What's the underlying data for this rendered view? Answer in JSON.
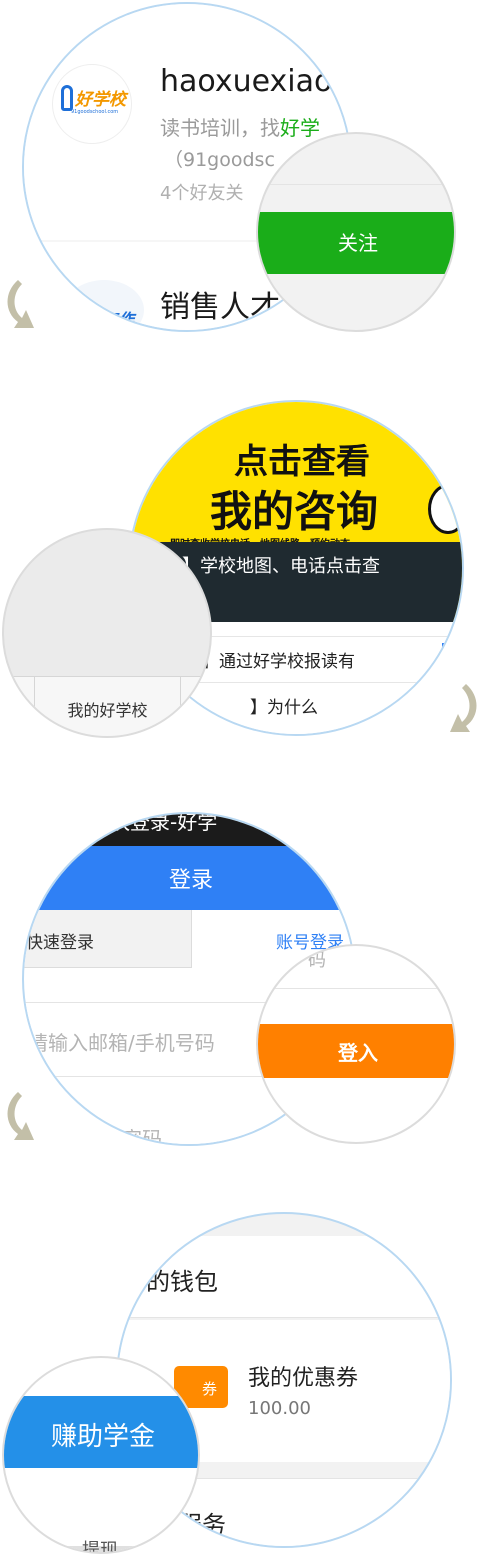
{
  "panel1": {
    "account_name": "haoxuexiao",
    "description_prefix": "读书培训，找",
    "description_highlight": "好学",
    "account_id": "（91goodsc",
    "friends_text": "4个好友关",
    "logo_text": "好学校",
    "logo_sub": "91goodschool.com",
    "next_account_name": "销售人才",
    "next_logo_text": "工作",
    "follow_button": "关注",
    "colors": {
      "follow": "#1aad19",
      "highlight": "#1aad19",
      "logo_blue": "#1e6fd8",
      "logo_orange": "#f39800"
    }
  },
  "panel2": {
    "banner_line1": "点击查看",
    "banner_line2": "我的咨询",
    "banner_sub": "即时查收学校电话，地图线路，预约动态",
    "caption": "询】学校地图、电话点击查",
    "list_item1": "】通过好学校报读有",
    "list_item2": "】为什么",
    "tab_label": "我的好学校",
    "colors": {
      "banner_yellow": "#ffe100",
      "caption_bg": "#222222"
    }
  },
  "panel3": {
    "title_bar": "快登录-好学",
    "header": "登录",
    "tab_quick": "快速登录",
    "tab_account": "账号登录",
    "email_placeholder": "请输入邮箱/手机号码",
    "password_placeholder": "密码",
    "verify_partial": "码",
    "login_button": "登入",
    "colors": {
      "header_blue": "#2f80f5",
      "tab_active": "#2f80f5",
      "login_orange": "#ff8000"
    }
  },
  "panel4": {
    "wallet": "的钱包",
    "coupon_title": "我的优惠券",
    "coupon_amount": "100.00",
    "coupon_icon": "券",
    "service": "服务",
    "service_bottom": "提现",
    "earn_button": "赚助学金",
    "colors": {
      "earn_blue": "#2490e8",
      "coupon_orange": "#ff8a00"
    }
  }
}
